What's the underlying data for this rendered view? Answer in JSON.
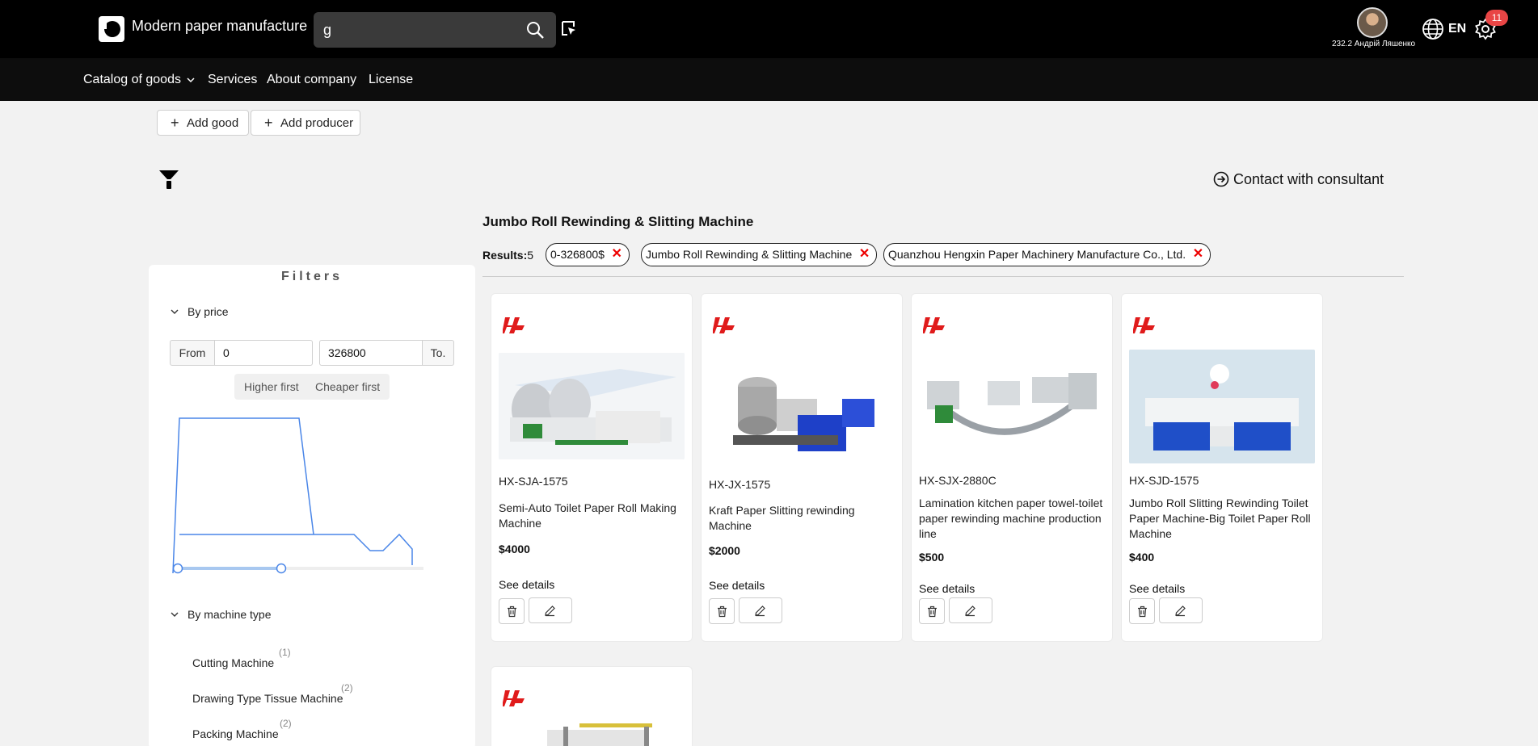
{
  "header": {
    "site_title": "Modern paper manufacture",
    "search_value": "g",
    "user_name": "232.2 Андрій Ляшенко",
    "language": "EN",
    "notifications_count": "11"
  },
  "nav": {
    "items": [
      "Catalog of goods",
      "Services",
      "About company",
      "License"
    ]
  },
  "actions": {
    "add_good": "Add good",
    "add_producer": "Add producer",
    "contact": "Contact with consultant"
  },
  "page": {
    "heading": "Jumbo Roll Rewinding & Slitting Machine",
    "results_label": "Results:",
    "results_count": "5",
    "chips": [
      "0-326800$",
      "Jumbo Roll Rewinding & Slitting Machine",
      "Quanzhou Hengxin Paper Machinery Manufacture Co., Ltd."
    ]
  },
  "filters": {
    "title": "Filters",
    "price_section": "By price",
    "from_label": "From",
    "from_value": "0",
    "to_value": "326800",
    "to_label": "To.",
    "sort_high": "Higher first",
    "sort_cheap": "Cheaper first",
    "type_section": "By machine type",
    "types": [
      {
        "name": "Cutting Machine",
        "count": "(1)"
      },
      {
        "name": "Drawing Type Tissue Machine",
        "count": "(2)"
      },
      {
        "name": "Packing Machine",
        "count": "(2)"
      }
    ]
  },
  "products": [
    {
      "code": "HX-SJA-1575",
      "name": "Semi-Auto Toilet Paper Roll Making Machine",
      "price": "$4000",
      "details": "See details"
    },
    {
      "code": "HX-JX-1575",
      "name": "Kraft Paper Slitting rewinding Machine",
      "price": "$2000",
      "details": "See details"
    },
    {
      "code": "HX-SJX-2880C",
      "name": "Lamination kitchen paper towel-toilet paper rewinding machine production line",
      "price": "$500",
      "details": "See details"
    },
    {
      "code": "HX-SJD-1575",
      "name": "Jumbo Roll Slitting Rewinding Toilet Paper Machine-Big Toilet Paper Roll Machine",
      "price": "$400",
      "details": "See details"
    }
  ],
  "colors": {
    "accent_blue": "#4a86e8",
    "brand_red": "#e01b1b",
    "chip_remove": "#e00000"
  }
}
